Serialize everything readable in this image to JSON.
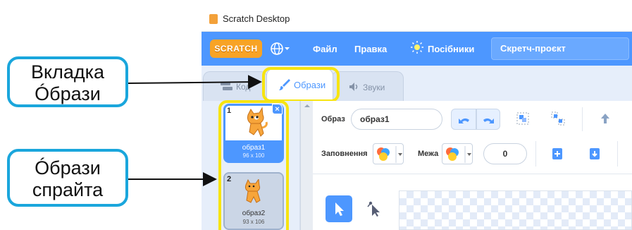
{
  "window": {
    "title": "Scratch Desktop"
  },
  "menubar": {
    "logo": "SCRATCH",
    "file": "Файл",
    "edit": "Правка",
    "tutorials": "Посібники",
    "project_title": "Скретч-проєкт"
  },
  "tabs": [
    {
      "label": "Код",
      "active": false
    },
    {
      "label": "Образи",
      "active": true
    },
    {
      "label": "Звуки",
      "active": false
    }
  ],
  "costumes": [
    {
      "number": "1",
      "name": "образ1",
      "size": "96 x 100",
      "selected": true
    },
    {
      "number": "2",
      "name": "образ2",
      "size": "93 x 106",
      "selected": false
    }
  ],
  "editor": {
    "costume_label": "Образ",
    "costume_name": "образ1",
    "fill_label": "Заповнення",
    "outline_label": "Межа",
    "outline_width": "0"
  },
  "callouts": {
    "tab": [
      "Вкладка",
      "Óбрази"
    ],
    "sprites": [
      "Óбрази",
      "спрайта"
    ]
  },
  "colors": {
    "scratch_blue": "#4d97ff",
    "callout_border": "#1aa6dc",
    "highlight": "#f7e411",
    "logo_orange": "#f8a325"
  }
}
